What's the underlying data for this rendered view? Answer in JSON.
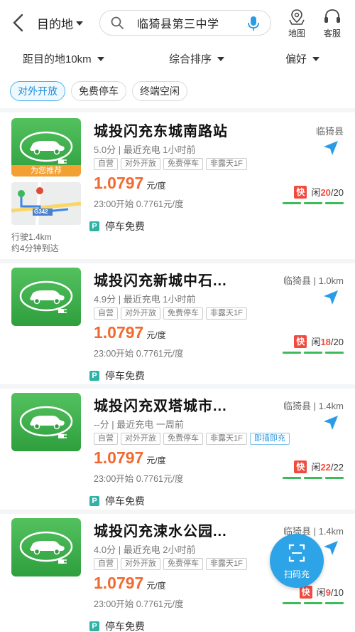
{
  "header": {
    "destination_label": "目的地",
    "search_text": "临猗县第三中学",
    "map_label": "地图",
    "service_label": "客服"
  },
  "filters": {
    "distance": "距目的地10km",
    "sort": "综合排序",
    "preference": "偏好"
  },
  "chips": [
    "对外开放",
    "免费停车",
    "终端空闲"
  ],
  "recommend_label": "为您推荐",
  "map_thumb": {
    "road": "G342",
    "distance": "行驶1.4km",
    "eta": "约4分钟到达"
  },
  "stations": [
    {
      "name": "城投闪充东城南路站",
      "region": "临猗县",
      "rating": "5.0分",
      "last_charge": "最近充电 1小时前",
      "tags": [
        "自营",
        "对外开放",
        "免费停车",
        "非露天1F"
      ],
      "price": "1.0797",
      "unit": "元/度",
      "price_note": "23:00开始 0.7761元/度",
      "fast": "快",
      "idle_label": "闲",
      "idle": "20",
      "total": "/20",
      "parking": "停车免费"
    },
    {
      "name": "城投闪充新城中石...",
      "region": "临猗县 | 1.0km",
      "rating": "4.9分",
      "last_charge": "最近充电 1小时前",
      "tags": [
        "自营",
        "对外开放",
        "免费停车",
        "非露天1F"
      ],
      "price": "1.0797",
      "unit": "元/度",
      "price_note": "23:00开始 0.7761元/度",
      "fast": "快",
      "idle_label": "闲",
      "idle": "18",
      "total": "/20",
      "parking": "停车免费"
    },
    {
      "name": "城投闪充双塔城市...",
      "region": "临猗县 | 1.4km",
      "rating": "--分",
      "last_charge": "最近充电 一周前",
      "tags": [
        "自营",
        "对外开放",
        "免费停车",
        "非露天1F",
        "即插即充"
      ],
      "price": "1.0797",
      "unit": "元/度",
      "price_note": "23:00开始 0.7761元/度",
      "fast": "快",
      "idle_label": "闲",
      "idle": "22",
      "total": "/22",
      "parking": "停车免费"
    },
    {
      "name": "城投闪充涑水公园...",
      "region": "临猗县 | 1.4km",
      "rating": "4.0分",
      "last_charge": "最近充电 2小时前",
      "tags": [
        "自营",
        "对外开放",
        "免费停车",
        "非露天1F"
      ],
      "price": "1.0797",
      "unit": "元/度",
      "price_note": "23:00开始 0.7761元/度",
      "fast": "快",
      "idle_label": "闲",
      "idle": "9",
      "total": "/10",
      "parking": "停车免费"
    }
  ],
  "scan_label": "扫码充"
}
